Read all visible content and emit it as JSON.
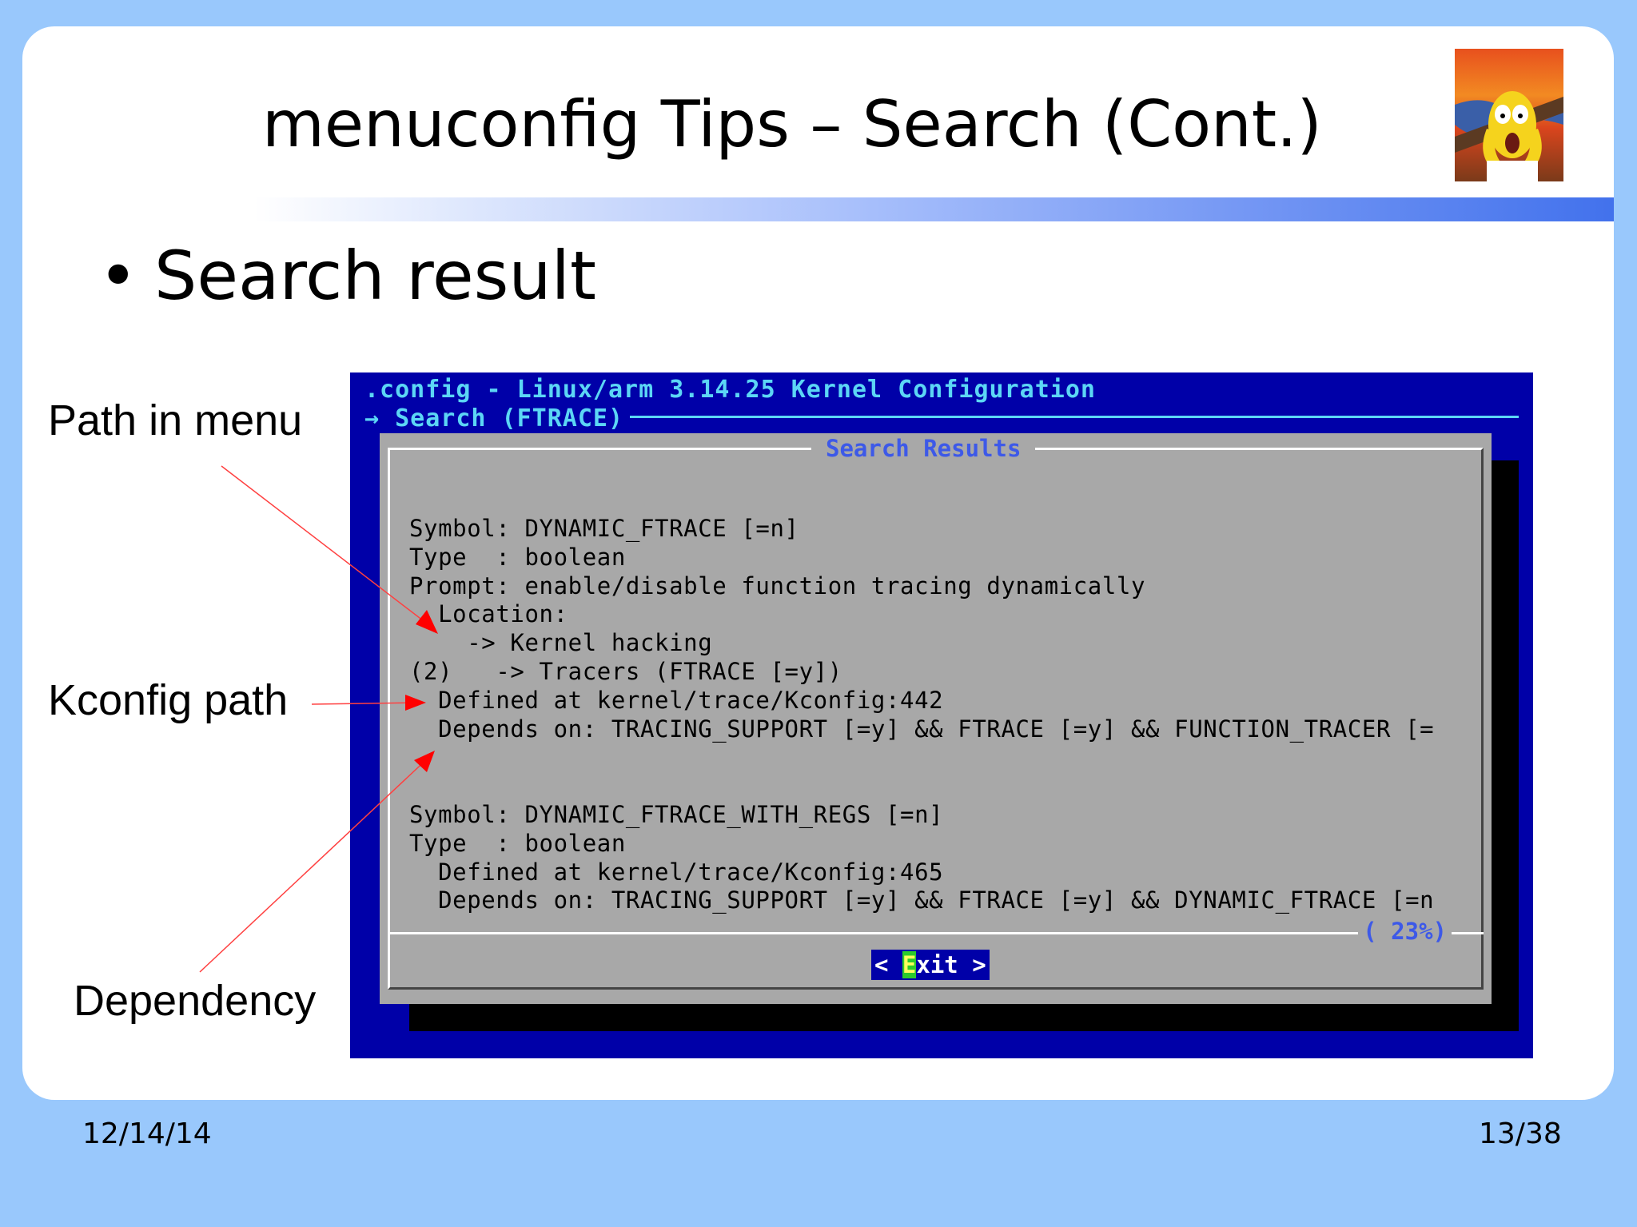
{
  "slide": {
    "title": "menuconfig Tips – Search (Cont.)",
    "bullet_marker": "•",
    "bullet": "Search result"
  },
  "annotations": {
    "path_in_menu": "Path in menu",
    "kconfig_path": "Kconfig path",
    "dependency": "Dependency",
    "arrow_color": "#ff0000"
  },
  "terminal": {
    "header_line": ".config - Linux/arm 3.14.25 Kernel Configuration",
    "breadcrumb": "→ Search (FTRACE)",
    "dialog_title": "Search Results",
    "results_text": "Symbol: DYNAMIC_FTRACE [=n]\nType  : boolean\nPrompt: enable/disable function tracing dynamically\n  Location:\n    -> Kernel hacking\n(2)   -> Tracers (FTRACE [=y])\n  Defined at kernel/trace/Kconfig:442\n  Depends on: TRACING_SUPPORT [=y] && FTRACE [=y] && FUNCTION_TRACER [=\n\n\nSymbol: DYNAMIC_FTRACE_WITH_REGS [=n]\nType  : boolean\n  Defined at kernel/trace/Kconfig:465\n  Depends on: TRACING_SUPPORT [=y] && FTRACE [=y] && DYNAMIC_FTRACE [=n",
    "scroll_percent": "( 23%)",
    "exit_left": "< ",
    "exit_hotkey": "E",
    "exit_rest": "xit >",
    "colors": {
      "background": "#0000a8",
      "dialog": "#a8a8a8",
      "header_text": "#5cd6f5",
      "title_text": "#3d59e8",
      "hotkey": "#2ccc2c"
    }
  },
  "footer": {
    "date": "12/14/14",
    "page": "13/38"
  }
}
